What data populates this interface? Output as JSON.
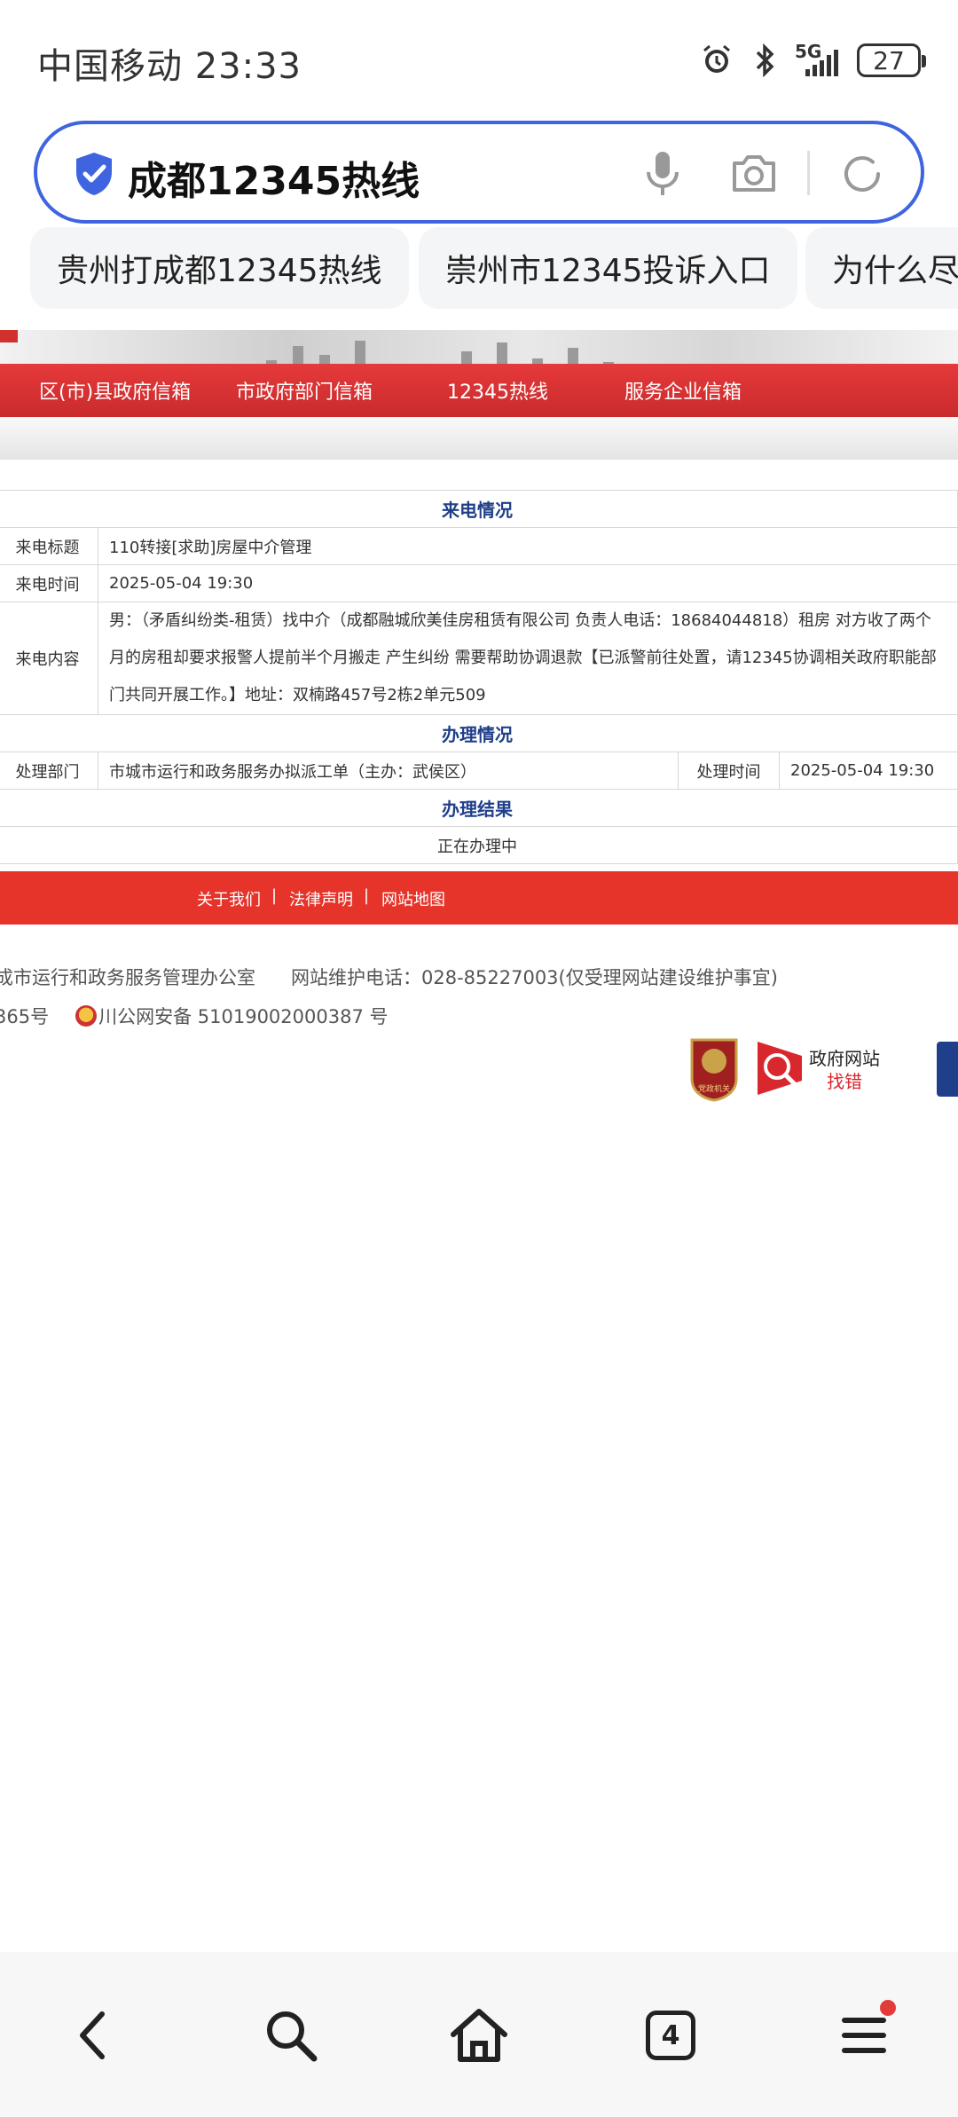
{
  "status_bar": {
    "carrier_time": "中国移动 23:33",
    "network": "5G",
    "battery": "27",
    "icons": [
      "alarm-icon",
      "bluetooth-icon",
      "signal-icon",
      "battery-icon"
    ]
  },
  "search": {
    "query": "成都12345热线",
    "icons": [
      "shield-check-icon",
      "mic-icon",
      "camera-icon",
      "refresh-icon"
    ],
    "accent": "#3e64e0"
  },
  "suggestions": [
    "贵州打成都12345热线",
    "崇州市12345投诉入口",
    "为什么尽"
  ],
  "webpage": {
    "nav": [
      "区(市)县政府信箱",
      "市政府部门信箱",
      "12345热线",
      "服务企业信箱"
    ],
    "sections": {
      "call_info": "来电情况",
      "handling_info": "办理情况",
      "handling_result": "办理结果"
    },
    "call": {
      "title_label": "来电标题",
      "title_value": "110转接[求助]房屋中介管理",
      "time_label": "来电时间",
      "time_value": "2025-05-04 19:30",
      "content_label": "来电内容",
      "content_value": "男：（矛盾纠纷类-租赁）找中介（成都融城欣美佳房租赁有限公司 负责人电话：18684044818）租房 对方收了两个月的房租却要求报警人提前半个月搬走 产生纠纷 需要帮助协调退款【已派警前往处置，请12345协调相关政府职能部门共同开展工作。】地址：双楠路457号2栋2单元509"
    },
    "handling": {
      "dept_label": "处理部门",
      "dept_value": "市城市运行和政务服务办拟派工单（主办：武侯区）",
      "time_label": "处理时间",
      "time_value": "2025-05-04 19:30"
    },
    "result_value": "正在办理中",
    "footer_links": [
      "关于我们",
      "法律声明",
      "网站地图"
    ],
    "footer_sep": "|",
    "footer_line1_a": "成市运行和政务服务管理办公室",
    "footer_line1_b": "网站维护电话：028-85227003(仅受理网站建设维护事宜)",
    "footer_line2_a": "365号",
    "footer_line2_b": "川公网安备 51019002000387 号",
    "badge_zhaocuo_line1": "政府网站",
    "badge_zhaocuo_line2": "找错",
    "badge_dangzheng": "党政机关",
    "brand_red": "#e6342b",
    "section_blue": "#1f3f8a"
  },
  "bottom_nav": {
    "tab_count": "4",
    "items": [
      "back-icon",
      "search-icon",
      "home-icon",
      "tabs-icon",
      "menu-icon"
    ]
  }
}
